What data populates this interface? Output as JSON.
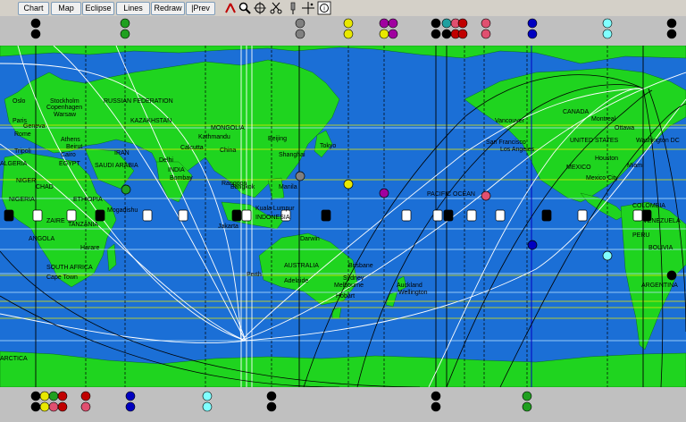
{
  "toolbar": {
    "buttons": [
      "Chart",
      "Map",
      "Eclipse",
      "Lines",
      "Redraw",
      "|Prev"
    ],
    "icons": [
      "astro-line-icon",
      "zoom-icon",
      "compass-icon",
      "scissors-icon",
      "pin-icon",
      "crosshair-icon",
      "info-icon"
    ]
  },
  "colors": {
    "ocean": "#1b6fd6",
    "land": "#1fd41f",
    "ice": "#1fd41f",
    "strip": "#c0c0c0"
  },
  "cities": [
    "Oslo",
    "Stockholm",
    "Copenhagen",
    "Warsaw",
    "Paris",
    "Geneva",
    "Rome",
    "Tripoli",
    "ALGERIA",
    "NIGER",
    "CHAD",
    "NIGERIA",
    "ZAIRE",
    "ANGOLA",
    "SOUTH AFRICA",
    "Cape Town",
    "Athens",
    "Beirut",
    "Cairo",
    "EGYPT",
    "SAUDI ARABIA",
    "ETHIOPIA",
    "TANZANIA",
    "Harare",
    "Mogadishu",
    "RUSSIAN FEDERATION",
    "KAZAKHSTAN",
    "IRAN",
    "Delhi",
    "INDIA",
    "Bombay",
    "Calcutta",
    "Kathmandu",
    "China",
    "MONGOLIA",
    "Beijing",
    "Shanghai",
    "Tokyo",
    "Rangoon",
    "Bangkok",
    "Manila",
    "Jakarta",
    "Kuala Lumpur",
    "INDONESIA",
    "Darwin",
    "AUSTRALIA",
    "Brisbane",
    "Sydney",
    "Melbourne",
    "Adelaide",
    "Hobart",
    "Perth",
    "Auckland",
    "Wellington",
    "PACIFIC OCEAN",
    "Vancouver",
    "San Francisco",
    "Los Angeles",
    "UNITED STATES",
    "MEXICO",
    "Mexico City",
    "Houston",
    "Miami",
    "Washington DC",
    "Montreal",
    "Ottawa",
    "CANADA",
    "VENEZUELA",
    "COLOMBIA",
    "PERU",
    "BOLIVIA",
    "ARGENTINA",
    "ARCTICA"
  ]
}
